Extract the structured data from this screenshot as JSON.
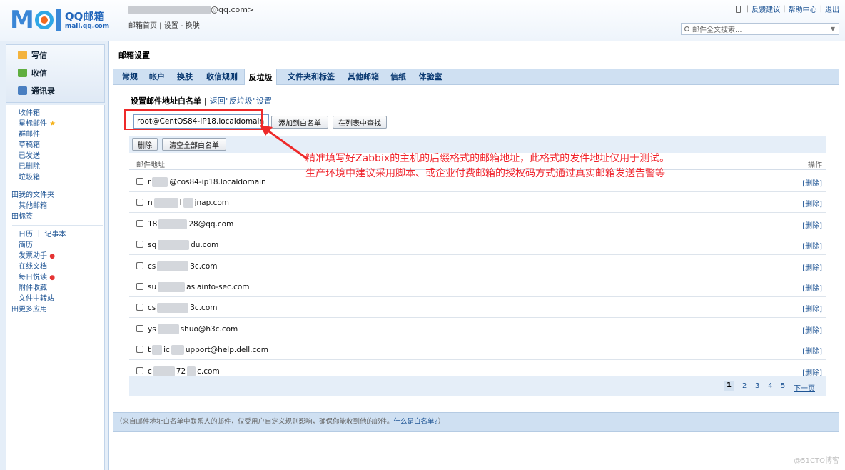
{
  "app": {
    "logo_main": "M",
    "logo_tail": "il",
    "logo_brand": "QQ邮箱",
    "logo_url": "mail.qq.com",
    "user_email_suffix": "@qq.com>",
    "links": "邮箱首页 | 设置 - 换肤"
  },
  "top_right": {
    "feedback": "反馈建议",
    "help": "帮助中心",
    "logout": "退出",
    "separator": "|"
  },
  "search": {
    "placeholder": "邮件全文搜索..."
  },
  "sidebar": {
    "quick": {
      "compose": "写信",
      "receive": "收信",
      "contacts": "通讯录"
    },
    "items": {
      "inbox": "收件箱",
      "starred": "星标邮件",
      "group": "群邮件",
      "drafts": "草稿箱",
      "sent": "已发送",
      "deleted": "已删除",
      "trash": "垃圾箱",
      "my_folders": "田我的文件夹",
      "other_mailbox": "其他邮箱",
      "tags": "田标签",
      "calendar": "日历 ｜ 记事本",
      "resume": "简历",
      "ticket": "发票助手",
      "docs": "在线文档",
      "daily": "每日悦读",
      "attachments": "附件收藏",
      "transfer": "文件中转站",
      "more_apps": "田更多应用"
    }
  },
  "main": {
    "title": "邮箱设置",
    "tabs": [
      "常规",
      "帐户",
      "换肤",
      "收信规则",
      "反垃圾",
      "文件夹和标签",
      "其他邮箱",
      "信纸",
      "体验室"
    ],
    "section_title": "设置邮件地址白名单",
    "section_sep": "|",
    "back_link": "返回\"反垃圾\"设置",
    "input_value": "root@CentOS84-IP18.localdomain",
    "add_button": "添加到白名单",
    "find_button": "在列表中查找",
    "delete_button": "删除",
    "clear_button": "清空全部白名单",
    "col_address": "邮件地址",
    "col_action": "操作",
    "rows": [
      {
        "a": "r",
        "b": "@c",
        "c": "os84-ip18.localdomain",
        "del": "[删除]"
      },
      {
        "a": "n",
        "b": "l",
        "c": "jnap.com",
        "del": "[删除]"
      },
      {
        "a": "18",
        "b": "",
        "c": "28@qq.com",
        "del": "[删除]"
      },
      {
        "a": "sq",
        "b": "",
        "c": "du.com",
        "del": "[删除]"
      },
      {
        "a": "cs",
        "b": "",
        "c": "3c.com",
        "del": "[删除]"
      },
      {
        "a": "su",
        "b": "",
        "c": "asiainfo-sec.com",
        "del": "[删除]"
      },
      {
        "a": "cs",
        "b": "",
        "c": "3c.com",
        "del": "[删除]"
      },
      {
        "a": "ys",
        "b": "",
        "c": "shuo@h3c.com",
        "del": "[删除]"
      },
      {
        "a": "t",
        "b": "ic",
        "c": "upport@help.dell.com",
        "del": "[删除]"
      },
      {
        "a": "c",
        "b": "72",
        "c": "c.com",
        "del": "[删除]"
      }
    ],
    "pager": {
      "p1": "1",
      "p2": "2",
      "p3": "3",
      "p4": "4",
      "p5": "5",
      "next": "下一页",
      "current": 1
    },
    "footnote": "（来自邮件地址白名单中联系人的邮件，仅受用户自定义规则影响，确保你能收到他的邮件。",
    "footnote_link": "什么是白名单?",
    "footnote_end": "）"
  },
  "annotation": {
    "line1": "精准填写好Zabbix的主机的后缀格式的邮箱地址，此格式的发件地址仅用于测试。",
    "line2": "生产环境中建议采用脚本、或企业付费邮箱的授权码方式通过真实邮箱发送告警等",
    "color": "#f0262e"
  },
  "watermark": "@51CTO博客"
}
